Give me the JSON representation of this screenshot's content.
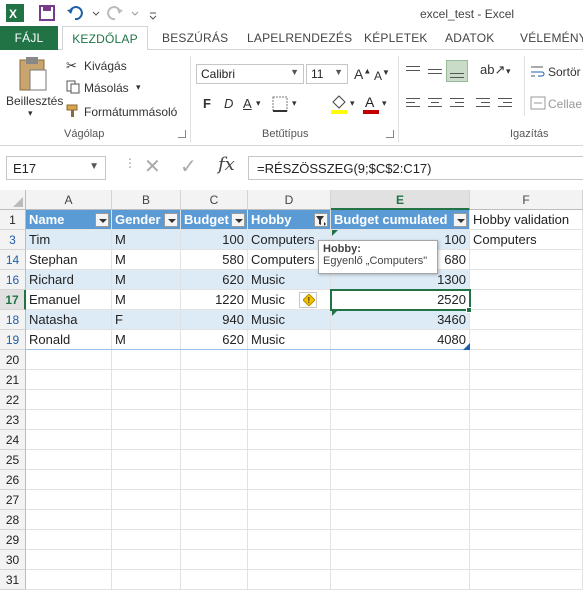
{
  "title": "excel_test - Excel",
  "ribbon_tabs": {
    "file": "FÁJL",
    "home": "KEZDŐLAP",
    "insert": "BESZÚRÁS",
    "page_layout": "LAPELRENDEZÉS",
    "formulas": "KÉPLETEK",
    "data": "ADATOK",
    "review": "VÉLEMÉNYE"
  },
  "clipboard": {
    "paste": "Beillesztés",
    "cut": "Kivágás",
    "copy": "Másolás",
    "format_painter": "Formátummásoló",
    "group_label": "Vágólap"
  },
  "font": {
    "name": "Calibri",
    "size": "11",
    "bold": "F",
    "italic": "D",
    "underline": "A",
    "group_label": "Betűtípus"
  },
  "alignment": {
    "group_label": "Igazítás",
    "sort": "Sortör",
    "merge": "Cellae"
  },
  "formula_bar": {
    "name_box": "E17",
    "formula": "=RÉSZÖSSZEG(9;$C$2:C17)",
    "fx": "fx"
  },
  "columns": [
    "A",
    "B",
    "C",
    "D",
    "E",
    "F"
  ],
  "header_row": {
    "row_number": "1",
    "cells": [
      "Name",
      "Gender",
      "Budget",
      "Hobby",
      "Budget cumulated",
      "Hobby validation"
    ]
  },
  "rows": [
    {
      "num": "3",
      "name": "Tim",
      "gender": "M",
      "budget": "100",
      "hobby": "Computers",
      "cum": "100",
      "validation": "Computers"
    },
    {
      "num": "14",
      "name": "Stephan",
      "gender": "M",
      "budget": "580",
      "hobby": "Computers",
      "cum": "680",
      "validation": ""
    },
    {
      "num": "16",
      "name": "Richard",
      "gender": "M",
      "budget": "620",
      "hobby": "Music",
      "cum": "1300",
      "validation": ""
    },
    {
      "num": "17",
      "name": "Emanuel",
      "gender": "M",
      "budget": "1220",
      "hobby": "Music",
      "cum": "2520",
      "validation": ""
    },
    {
      "num": "18",
      "name": "Natasha",
      "gender": "F",
      "budget": "940",
      "hobby": "Music",
      "cum": "3460",
      "validation": ""
    },
    {
      "num": "19",
      "name": "Ronald",
      "gender": "M",
      "budget": "620",
      "hobby": "Music",
      "cum": "4080",
      "validation": ""
    }
  ],
  "empty_rows": [
    "20",
    "21",
    "22",
    "23",
    "24",
    "25",
    "26",
    "27",
    "28",
    "29",
    "30",
    "31"
  ],
  "tooltip": {
    "title": "Hobby:",
    "text": "Egyenlő „Computers\""
  },
  "colors": {
    "excel_green": "#217346",
    "table_header": "#5b9bd5",
    "table_band": "#ddebf7"
  }
}
